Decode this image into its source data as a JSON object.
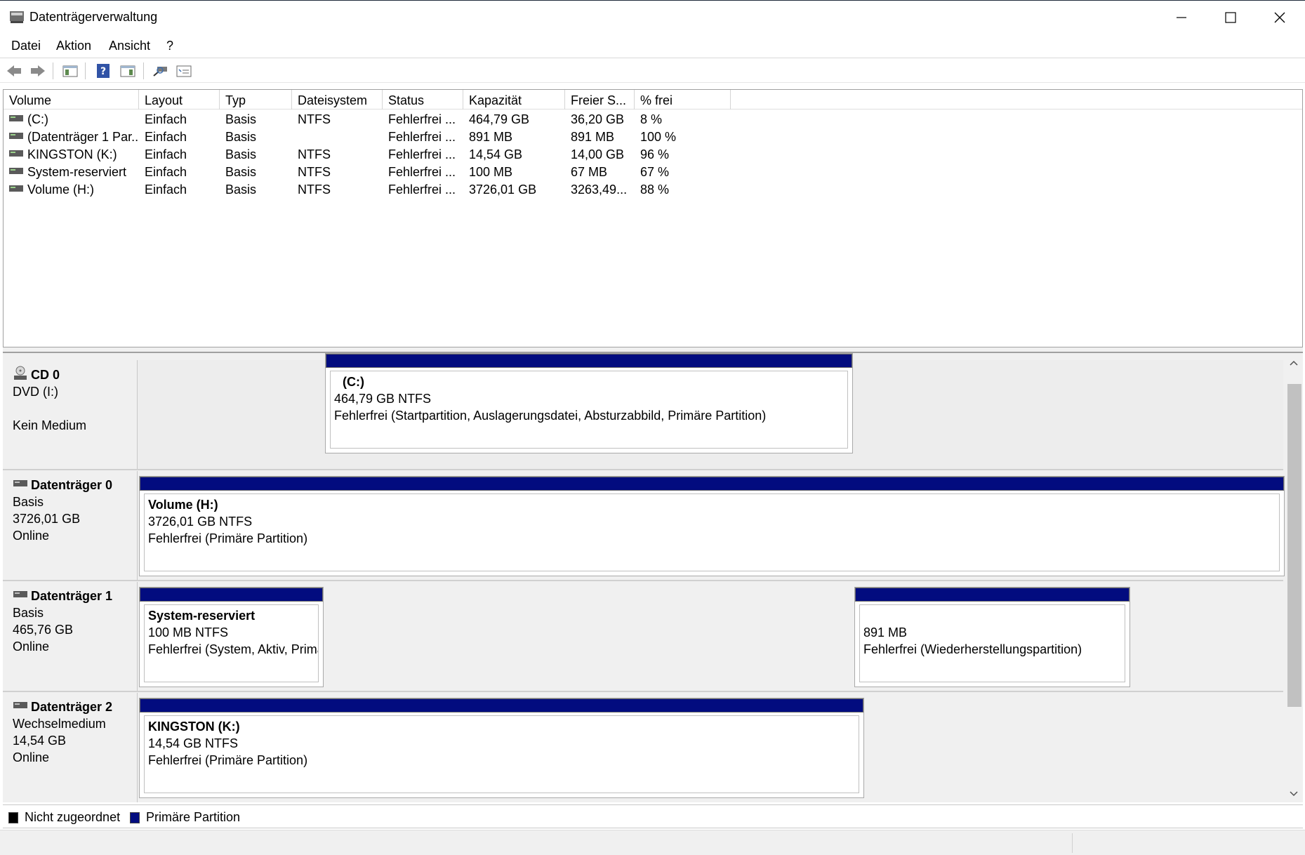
{
  "window": {
    "title": "Datenträgerverwaltung"
  },
  "menu": {
    "items": [
      "Datei",
      "Aktion",
      "Ansicht",
      "?"
    ]
  },
  "toolbar": {
    "icons": [
      "back-arrow-icon",
      "forward-arrow-icon",
      "console-tree-icon",
      "help-icon",
      "action-pane-icon",
      "rescan-disks-icon",
      "properties-icon"
    ]
  },
  "volume_list": {
    "columns": [
      "Volume",
      "Layout",
      "Typ",
      "Dateisystem",
      "Status",
      "Kapazität",
      "Freier S...",
      "% frei"
    ],
    "rows": [
      [
        "(C:)",
        "Einfach",
        "Basis",
        "NTFS",
        "Fehlerfrei ...",
        "464,79 GB",
        "36,20 GB",
        "8 %"
      ],
      [
        "(Datenträger 1 Par...",
        "Einfach",
        "Basis",
        "",
        "Fehlerfrei ...",
        "891 MB",
        "891 MB",
        "100 %"
      ],
      [
        "KINGSTON (K:)",
        "Einfach",
        "Basis",
        "NTFS",
        "Fehlerfrei ...",
        "14,54 GB",
        "14,00 GB",
        "96 %"
      ],
      [
        "System-reserviert",
        "Einfach",
        "Basis",
        "NTFS",
        "Fehlerfrei ...",
        "100 MB",
        "67 MB",
        "67 %"
      ],
      [
        "Volume (H:)",
        "Einfach",
        "Basis",
        "NTFS",
        "Fehlerfrei ...",
        "3726,01 GB",
        "3263,49...",
        "88 %"
      ]
    ]
  },
  "disks": {
    "cd0": {
      "name": "CD 0",
      "line1": "DVD (I:)",
      "line2": "",
      "line3": "Kein Medium"
    },
    "disk0": {
      "name": "Datenträger 0",
      "type": "Basis",
      "size": "3726,01 GB",
      "state": "Online",
      "partitions": [
        {
          "name": "Volume  (H:)",
          "size": "3726,01 GB NTFS",
          "status": "Fehlerfrei (Primäre Partition)"
        }
      ]
    },
    "disk1": {
      "name": "Datenträger 1",
      "type": "Basis",
      "size": "465,76 GB",
      "state": "Online",
      "partitions": [
        {
          "name": "System-reserviert",
          "size": "100 MB NTFS",
          "status": "Fehlerfrei (System, Aktiv, Primä"
        },
        {
          "name": "(C:)",
          "size": "464,79 GB NTFS",
          "status": "Fehlerfrei (Startpartition, Auslagerungsdatei, Absturzabbild, Primäre Partition)"
        },
        {
          "name": "",
          "size": "891 MB",
          "status": "Fehlerfrei (Wiederherstellungspartition)"
        }
      ]
    },
    "disk2": {
      "name": "Datenträger 2",
      "type": "Wechselmedium",
      "size": "14,54 GB",
      "state": "Online",
      "partitions": [
        {
          "name": "KINGSTON  (K:)",
          "size": "14,54 GB NTFS",
          "status": "Fehlerfrei (Primäre Partition)"
        }
      ]
    }
  },
  "legend": {
    "unallocated": "Nicht zugeordnet",
    "primary": "Primäre Partition",
    "unallocated_color": "#000000",
    "primary_color": "#020c7f"
  }
}
